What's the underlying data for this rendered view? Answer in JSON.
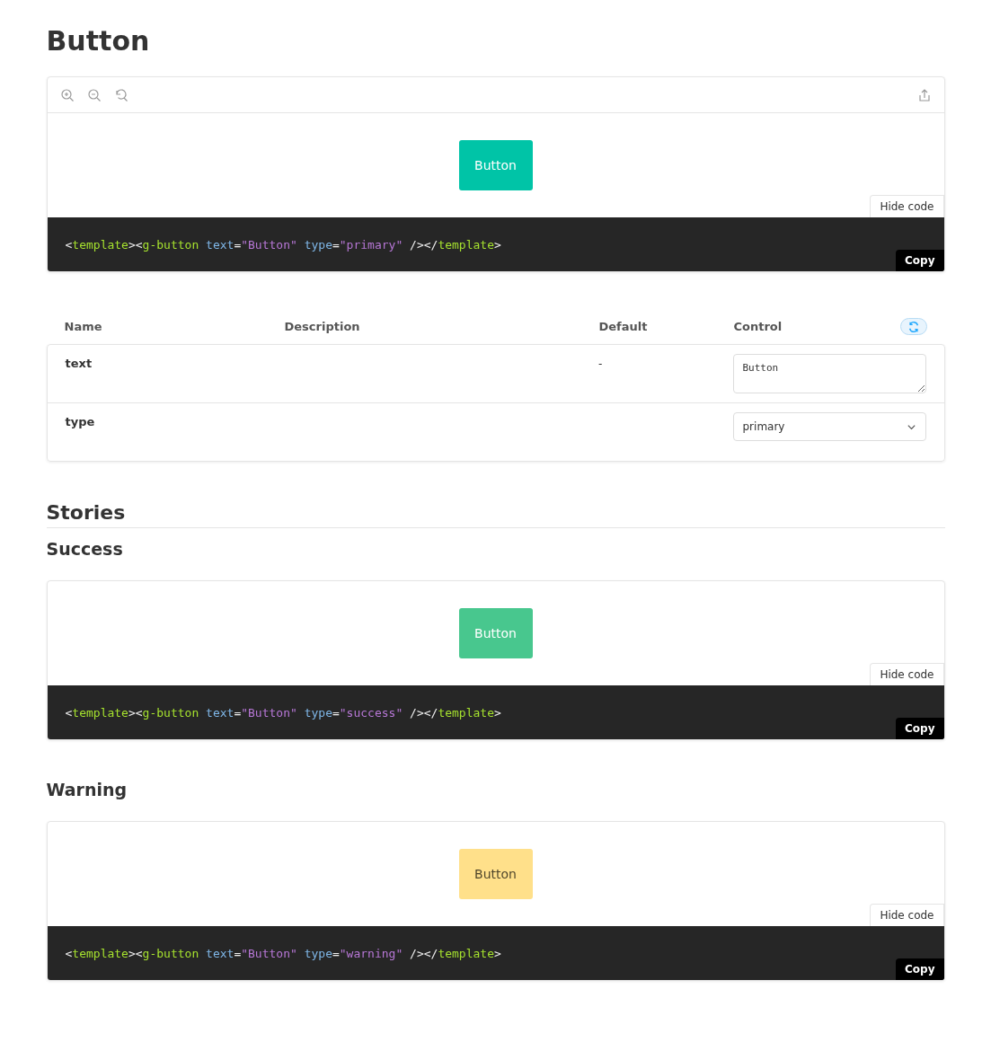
{
  "title": "Button",
  "demo": {
    "button": {
      "text": "Button",
      "color": "#00c4a7"
    },
    "hide_code": "Hide code",
    "copy": "Copy",
    "code": [
      {
        "kind": "punct",
        "text": "<"
      },
      {
        "kind": "tag",
        "text": "template"
      },
      {
        "kind": "punct",
        "text": "><"
      },
      {
        "kind": "tag",
        "text": "g-button"
      },
      {
        "kind": "attr",
        "text": " text"
      },
      {
        "kind": "punct",
        "text": "="
      },
      {
        "kind": "string",
        "text": "\"Button\""
      },
      {
        "kind": "attr",
        "text": " type"
      },
      {
        "kind": "punct",
        "text": "="
      },
      {
        "kind": "string",
        "text": "\"primary\""
      },
      {
        "kind": "punct",
        "text": " /></"
      },
      {
        "kind": "tag",
        "text": "template"
      },
      {
        "kind": "punct",
        "text": ">"
      }
    ]
  },
  "args_table": {
    "columns": [
      "Name",
      "Description",
      "Default",
      "Control"
    ],
    "rows": [
      {
        "name": "text",
        "default": "-",
        "control": {
          "kind": "textarea",
          "value": "Button"
        }
      },
      {
        "name": "type",
        "control": {
          "kind": "select",
          "value": "primary"
        }
      }
    ]
  },
  "stories": {
    "title": "Stories",
    "items": [
      {
        "title": "Success",
        "demo": {
          "button": {
            "text": "Button",
            "color": "#48c78e"
          },
          "hide_code": "Hide code",
          "copy": "Copy",
          "code": [
            {
              "kind": "punct",
              "text": "<"
            },
            {
              "kind": "tag",
              "text": "template"
            },
            {
              "kind": "punct",
              "text": "><"
            },
            {
              "kind": "tag",
              "text": "g-button"
            },
            {
              "kind": "attr",
              "text": " text"
            },
            {
              "kind": "punct",
              "text": "="
            },
            {
              "kind": "string",
              "text": "\"Button\""
            },
            {
              "kind": "attr",
              "text": " type"
            },
            {
              "kind": "punct",
              "text": "="
            },
            {
              "kind": "string",
              "text": "\"success\""
            },
            {
              "kind": "punct",
              "text": " /></"
            },
            {
              "kind": "tag",
              "text": "template"
            },
            {
              "kind": "punct",
              "text": ">"
            }
          ]
        }
      },
      {
        "title": "Warning",
        "demo": {
          "button": {
            "text": "Button",
            "color": "#ffe08a"
          },
          "hide_code": "Hide code",
          "copy": "Copy",
          "code": [
            {
              "kind": "punct",
              "text": "<"
            },
            {
              "kind": "tag",
              "text": "template"
            },
            {
              "kind": "punct",
              "text": "><"
            },
            {
              "kind": "tag",
              "text": "g-button"
            },
            {
              "kind": "attr",
              "text": " text"
            },
            {
              "kind": "punct",
              "text": "="
            },
            {
              "kind": "string",
              "text": "\"Button\""
            },
            {
              "kind": "attr",
              "text": " type"
            },
            {
              "kind": "punct",
              "text": "="
            },
            {
              "kind": "string",
              "text": "\"warning\""
            },
            {
              "kind": "punct",
              "text": " /></"
            },
            {
              "kind": "tag",
              "text": "template"
            },
            {
              "kind": "punct",
              "text": ">"
            }
          ]
        }
      }
    ]
  }
}
